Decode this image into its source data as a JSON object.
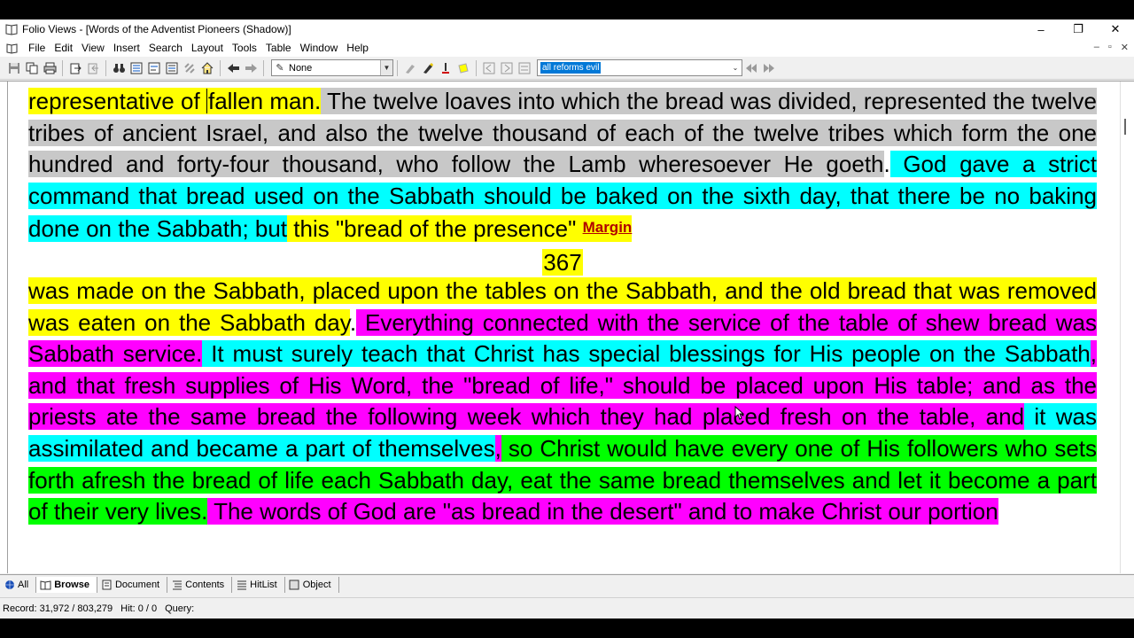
{
  "window": {
    "title": "Folio Views - [Words of the Adventist Pioneers (Shadow)]",
    "minimize": "–",
    "restore": "❐",
    "close": "✕"
  },
  "menu": {
    "items": [
      "File",
      "Edit",
      "View",
      "Insert",
      "Search",
      "Layout",
      "Tools",
      "Table",
      "Window",
      "Help"
    ],
    "mdi": [
      "–",
      "▫",
      "✕"
    ]
  },
  "toolbar": {
    "style_value": "None",
    "query_value": "all reforms evil",
    "icons": [
      "save-icon",
      "copy-icon",
      "print-icon",
      "export-icon",
      "import-icon",
      "binoculars-icon",
      "document-search-icon",
      "query-icon",
      "hit-list-icon",
      "link-icon",
      "home-icon",
      "back-arrow-icon",
      "forward-arrow-icon",
      "highlighter-icon",
      "marker-icon",
      "note-icon",
      "first-hit-icon",
      "next-hit-icon",
      "rewind-icon",
      "fast-forward-icon"
    ]
  },
  "document": {
    "para1": {
      "s1": "representative of ",
      "s1b": "fallen man.",
      "s2": " The twelve loaves into which the bread was divided, represented the twelve tribes of ancient Israel, and also the twelve thousand of each of the twelve tribes which form the one hundred and forty-four thousand, who follow the Lamb wheresoever He goeth",
      "s2end": ".",
      "s3": " God gave a strict command that bread used on the Sabbath should be baked on the sixth day, that there be no baking done on the Sabbath; but",
      "s4": " this \"bread of the presence\" ",
      "margin": "Margin"
    },
    "page_number": "367",
    "para2": {
      "s1": "was made on the Sabbath, placed upon the tables on the Sabbath, and the old bread that was removed was eaten on the Sabbath day",
      "s1end": ".",
      "s2": " Everything connected with the service of the table of shew bread was Sabbath service.",
      "s3": " It must surely teach that Christ has special blessings for His people on the Sabbath",
      "s4": ", and that fresh supplies of His Word, the \"bread of life,\" should be placed upon His table; and as the priests ate the same bread the following week which they had placed fresh on the table, and",
      "s5": " it was assimilated and became a part of themselves",
      "s5end": ",",
      "s6": " so Christ would have every one of His followers who sets forth afresh the bread of life each Sabbath day, eat the same bread themselves and let it become a part of their",
      "s7": " very lives.",
      "s8": " The words of God are \"as bread in the desert\" and to make Christ our portion"
    }
  },
  "tabs": [
    "All",
    "Browse",
    "Document",
    "Contents",
    "HitList",
    "Object"
  ],
  "status": {
    "record": "Record: 31,972 / 803,279",
    "hit": "Hit: 0 / 0",
    "query": "Query:"
  },
  "colors": {
    "yellow": "#ffff00",
    "gray": "#c8c8c8",
    "cyan": "#00ffff",
    "magenta": "#ff00ff",
    "green": "#00ff00",
    "margin_link": "#b00000"
  }
}
